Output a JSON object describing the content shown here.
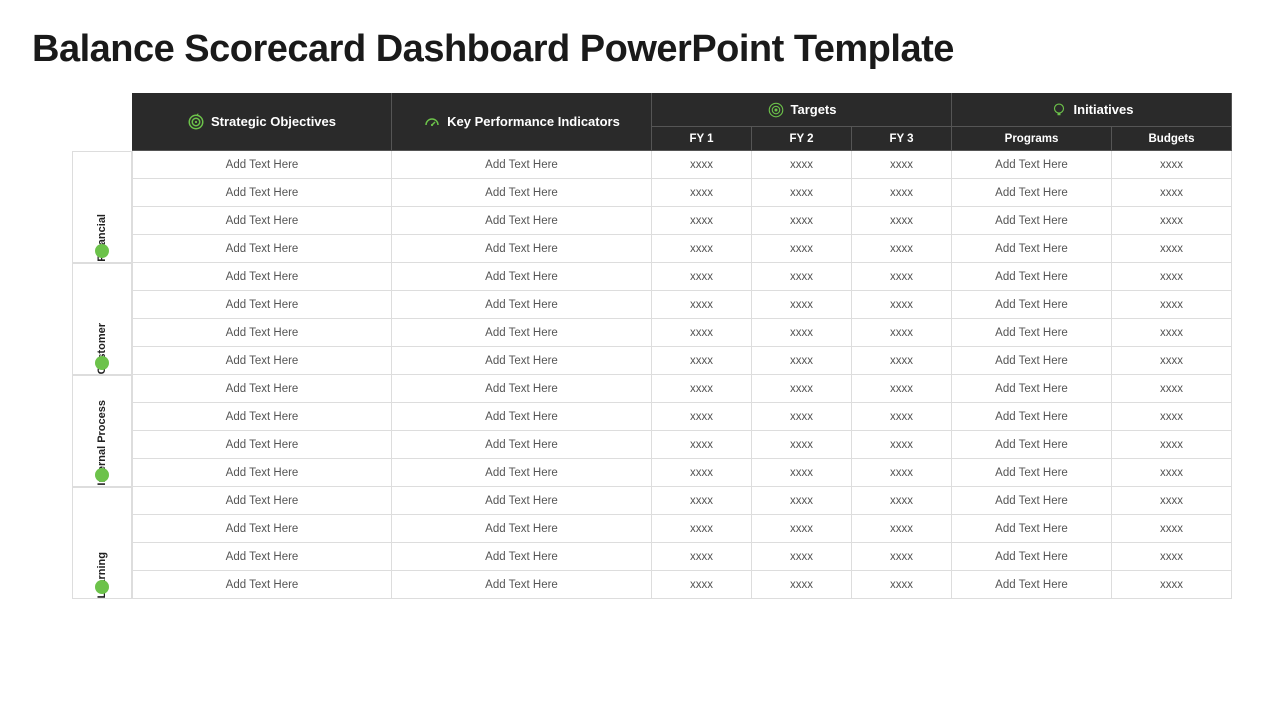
{
  "title": "Balance Scorecard Dashboard PowerPoint Template",
  "header": {
    "strategic": "Strategic Objectives",
    "kpi": "Key Performance Indicators",
    "targets": "Targets",
    "initiatives": "Initiatives",
    "fy1": "FY 1",
    "fy2": "FY 2",
    "fy3": "FY 3",
    "programs": "Programs",
    "budgets": "Budgets"
  },
  "sections": [
    {
      "label": "Financial",
      "rows": [
        {
          "obj": "Add Text Here",
          "kpi": "Add Text Here",
          "fy1": "xxxx",
          "fy2": "xxxx",
          "fy3": "xxxx",
          "prog": "Add Text Here",
          "bud": "xxxx"
        },
        {
          "obj": "Add Text Here",
          "kpi": "Add Text Here",
          "fy1": "xxxx",
          "fy2": "xxxx",
          "fy3": "xxxx",
          "prog": "Add Text Here",
          "bud": "xxxx"
        },
        {
          "obj": "Add Text Here",
          "kpi": "Add Text Here",
          "fy1": "xxxx",
          "fy2": "xxxx",
          "fy3": "xxxx",
          "prog": "Add Text Here",
          "bud": "xxxx"
        },
        {
          "obj": "Add Text Here",
          "kpi": "Add Text Here",
          "fy1": "xxxx",
          "fy2": "xxxx",
          "fy3": "xxxx",
          "prog": "Add Text Here",
          "bud": "xxxx"
        }
      ]
    },
    {
      "label": "Customer",
      "rows": [
        {
          "obj": "Add Text Here",
          "kpi": "Add Text Here",
          "fy1": "xxxx",
          "fy2": "xxxx",
          "fy3": "xxxx",
          "prog": "Add Text Here",
          "bud": "xxxx"
        },
        {
          "obj": "Add Text Here",
          "kpi": "Add Text Here",
          "fy1": "xxxx",
          "fy2": "xxxx",
          "fy3": "xxxx",
          "prog": "Add Text Here",
          "bud": "xxxx"
        },
        {
          "obj": "Add Text Here",
          "kpi": "Add Text Here",
          "fy1": "xxxx",
          "fy2": "xxxx",
          "fy3": "xxxx",
          "prog": "Add Text Here",
          "bud": "xxxx"
        },
        {
          "obj": "Add Text Here",
          "kpi": "Add Text Here",
          "fy1": "xxxx",
          "fy2": "xxxx",
          "fy3": "xxxx",
          "prog": "Add Text Here",
          "bud": "xxxx"
        }
      ]
    },
    {
      "label": "Internal Process",
      "rows": [
        {
          "obj": "Add Text Here",
          "kpi": "Add Text Here",
          "fy1": "xxxx",
          "fy2": "xxxx",
          "fy3": "xxxx",
          "prog": "Add Text Here",
          "bud": "xxxx"
        },
        {
          "obj": "Add Text Here",
          "kpi": "Add Text Here",
          "fy1": "xxxx",
          "fy2": "xxxx",
          "fy3": "xxxx",
          "prog": "Add Text Here",
          "bud": "xxxx"
        },
        {
          "obj": "Add Text Here",
          "kpi": "Add Text Here",
          "fy1": "xxxx",
          "fy2": "xxxx",
          "fy3": "xxxx",
          "prog": "Add Text Here",
          "bud": "xxxx"
        },
        {
          "obj": "Add Text Here",
          "kpi": "Add Text Here",
          "fy1": "xxxx",
          "fy2": "xxxx",
          "fy3": "xxxx",
          "prog": "Add Text Here",
          "bud": "xxxx"
        }
      ]
    },
    {
      "label": "Learning",
      "rows": [
        {
          "obj": "Add Text Here",
          "kpi": "Add Text Here",
          "fy1": "xxxx",
          "fy2": "xxxx",
          "fy3": "xxxx",
          "prog": "Add Text Here",
          "bud": "xxxx"
        },
        {
          "obj": "Add Text Here",
          "kpi": "Add Text Here",
          "fy1": "xxxx",
          "fy2": "xxxx",
          "fy3": "xxxx",
          "prog": "Add Text Here",
          "bud": "xxxx"
        },
        {
          "obj": "Add Text Here",
          "kpi": "Add Text Here",
          "fy1": "xxxx",
          "fy2": "xxxx",
          "fy3": "xxxx",
          "prog": "Add Text Here",
          "bud": "xxxx"
        },
        {
          "obj": "Add Text Here",
          "kpi": "Add Text Here",
          "fy1": "xxxx",
          "fy2": "xxxx",
          "fy3": "xxxx",
          "prog": "Add Text Here",
          "bud": "xxxx"
        }
      ]
    }
  ]
}
